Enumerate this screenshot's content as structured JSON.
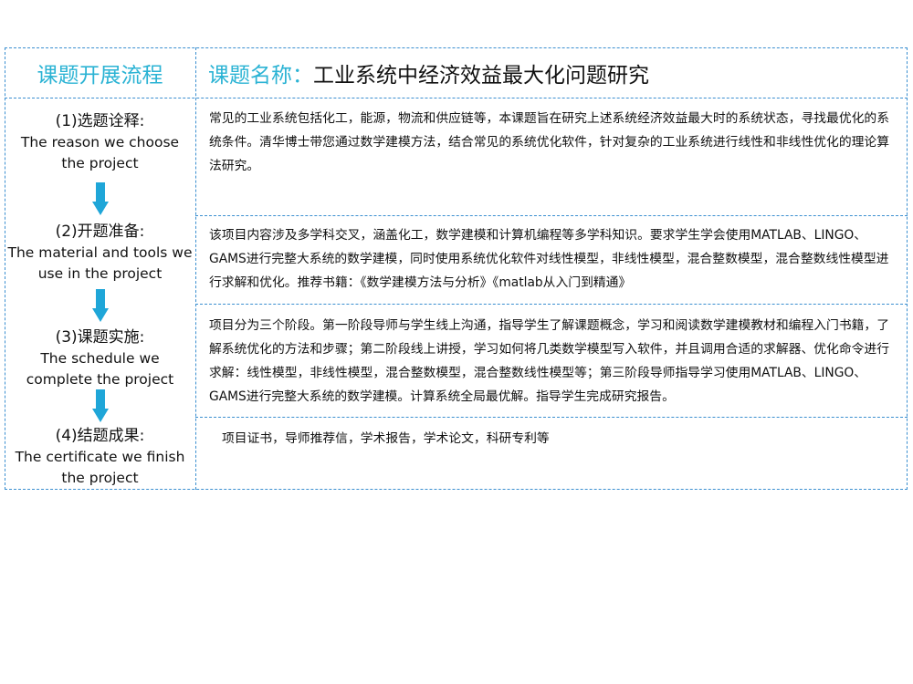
{
  "header": {
    "left": "课题开展流程",
    "right_label": "课题名称：",
    "right_title": "工业系统中经济效益最大化问题研究"
  },
  "steps": [
    {
      "cn": "(1)选题诠释:",
      "en": "The reason we choose\nthe project"
    },
    {
      "cn": "(2)开题准备:",
      "en": "The material and tools we\nuse in the project"
    },
    {
      "cn": "(3)课题实施:",
      "en": "The schedule we\ncomplete the project"
    },
    {
      "cn": "(4)结题成果:",
      "en": "The certificate we finish\nthe project"
    }
  ],
  "descriptions": [
    "常见的工业系统包括化工，能源，物流和供应链等，本课题旨在研究上述系统经济效益最大时的系统状态，寻找最优化的系统条件。清华博士带您通过数学建模方法，结合常见的系统优化软件，针对复杂的工业系统进行线性和非线性优化的理论算法研究。",
    "该项目内容涉及多学科交叉，涵盖化工，数学建模和计算机编程等多学科知识。要求学生学会使用MATLAB、LINGO、GAMS进行完整大系统的数学建模，同时使用系统优化软件对线性模型，非线性模型，混合整数模型，混合整数线性模型进行求解和优化。推荐书籍：《数学建模方法与分析》《matlab从入门到精通》",
    "项目分为三个阶段。第一阶段导师与学生线上沟通，指导学生了解课题概念，学习和阅读数学建模教材和编程入门书籍，了解系统优化的方法和步骤；第二阶段线上讲授，学习如何将几类数学模型写入软件，并且调用合适的求解器、优化命令进行求解：线性模型，非线性模型，混合整数模型，混合整数线性模型等；第三阶段导师指导学习使用MATLAB、LINGO、GAMS进行完整大系统的数学建模。计算系统全局最优解。指导学生完成研究报告。",
    "项目证书，导师推荐信，学术报告，学术论文，科研专利等"
  ]
}
